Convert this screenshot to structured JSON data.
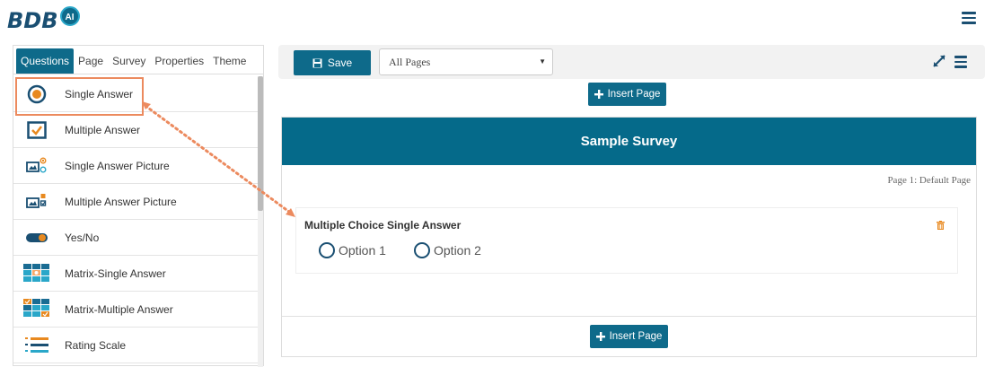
{
  "app": {
    "logo_text": "BDB",
    "logo_badge": "AI"
  },
  "left_panel": {
    "tabs": [
      {
        "label": "Questions",
        "active": true
      },
      {
        "label": "Page"
      },
      {
        "label": "Survey"
      },
      {
        "label": "Properties"
      },
      {
        "label": "Theme"
      }
    ],
    "questions": [
      {
        "label": "Single Answer",
        "icon": "radio-circle-icon"
      },
      {
        "label": "Multiple Answer",
        "icon": "checkbox-icon"
      },
      {
        "label": "Single Answer Picture",
        "icon": "picture-radio-icon"
      },
      {
        "label": "Multiple Answer Picture",
        "icon": "picture-checkbox-icon"
      },
      {
        "label": "Yes/No",
        "icon": "toggle-icon"
      },
      {
        "label": "Matrix-Single Answer",
        "icon": "matrix-single-icon"
      },
      {
        "label": "Matrix-Multiple Answer",
        "icon": "matrix-multiple-icon"
      },
      {
        "label": "Rating Scale",
        "icon": "rating-scale-icon"
      }
    ]
  },
  "toolbar": {
    "save_label": "Save",
    "page_select_value": "All Pages"
  },
  "insert_page_label": "Insert Page",
  "survey": {
    "title": "Sample Survey",
    "page_label": "Page 1:  Default Page",
    "question": {
      "title": "Multiple Choice Single Answer",
      "options": [
        "Option 1",
        "Option 2"
      ]
    }
  },
  "colors": {
    "primary": "#0e6a8a",
    "header": "#056a8a",
    "accent": "#ec8a5e",
    "icon_orange": "#e8891f"
  }
}
